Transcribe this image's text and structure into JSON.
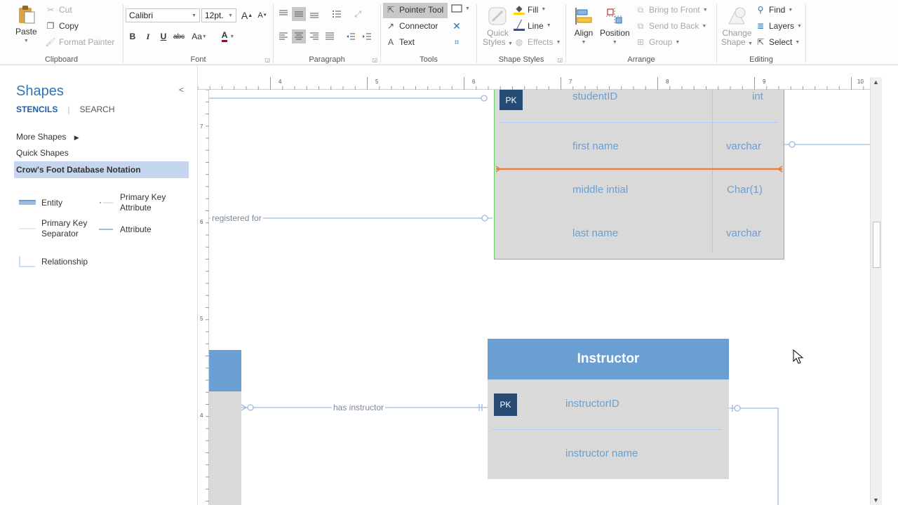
{
  "ribbon": {
    "clipboard": {
      "label": "Clipboard",
      "paste": "Paste",
      "cut": "Cut",
      "copy": "Copy",
      "format_painter": "Format Painter"
    },
    "font": {
      "label": "Font",
      "family": "Calibri",
      "size": "12pt.",
      "bold": "B",
      "italic": "I",
      "underline": "U",
      "strike": "abc",
      "case": "Aa",
      "color": "A",
      "grow": "A",
      "shrink": "A"
    },
    "paragraph": {
      "label": "Paragraph"
    },
    "tools": {
      "label": "Tools",
      "pointer": "Pointer Tool",
      "connector": "Connector",
      "text": "Text",
      "text_icon": "A"
    },
    "shape_styles": {
      "label": "Shape Styles",
      "quick_styles_1": "Quick",
      "quick_styles_2": "Styles",
      "fill": "Fill",
      "line": "Line",
      "effects": "Effects"
    },
    "arrange": {
      "label": "Arrange",
      "align": "Align",
      "position": "Position",
      "bring_front": "Bring to Front",
      "send_back": "Send to Back",
      "group": "Group"
    },
    "editing": {
      "label": "Editing",
      "change_shape_1": "Change",
      "change_shape_2": "Shape",
      "find": "Find",
      "layers": "Layers",
      "select": "Select"
    }
  },
  "pane": {
    "title": "Shapes",
    "tabs": {
      "stencils": "STENCILS",
      "search": "SEARCH"
    },
    "more_shapes": "More Shapes",
    "quick_shapes": "Quick Shapes",
    "active_stencil": "Crow's Foot Database Notation",
    "shapes": {
      "entity": "Entity",
      "pk_attr_1": "Primary Key",
      "pk_attr_2": "Attribute",
      "pk_sep_1": "Primary Key",
      "pk_sep_2": "Separator",
      "attribute": "Attribute",
      "relationship": "Relationship"
    }
  },
  "ruler": {
    "h": [
      "4",
      "5",
      "6",
      "7",
      "8",
      "9",
      "10"
    ],
    "v": [
      "7",
      "6",
      "5",
      "4"
    ]
  },
  "diagram": {
    "student": {
      "pk": "PK",
      "rows": [
        {
          "name": "studentID",
          "type": "int"
        },
        {
          "name": "first name",
          "type": "varchar"
        },
        {
          "name": "middle intial",
          "type": "Char(1)"
        },
        {
          "name": "last name",
          "type": "varchar"
        }
      ]
    },
    "instructor": {
      "title": "Instructor",
      "pk": "PK",
      "rows": [
        {
          "name": "instructorID"
        },
        {
          "name": "instructor name"
        }
      ]
    },
    "relationships": {
      "registered_for": "registered for",
      "has_instructor": "has instructor"
    }
  },
  "colors": {
    "accent": "#2e75b6",
    "entity_header": "#6a9fd3",
    "entity_body": "#d9d9d9",
    "pk_badge": "#254b73",
    "selection": "#66cc66",
    "selected_connector": "#ed7d31"
  }
}
